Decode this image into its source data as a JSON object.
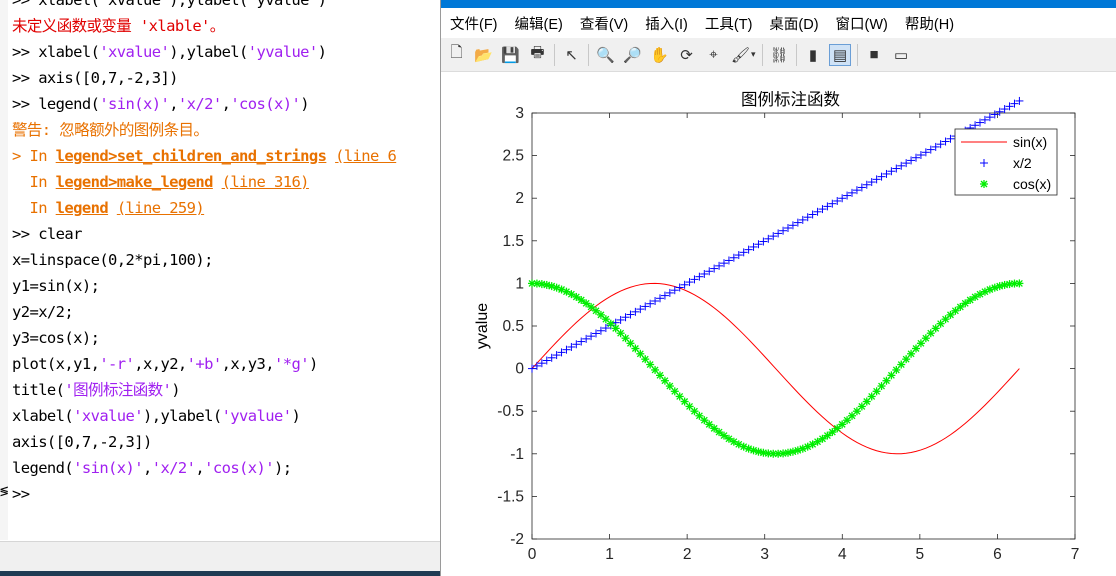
{
  "command_window": {
    "lines": [
      [
        {
          "t": ">> xlabel('xvalue'),ylabel('yvalue')",
          "c": ""
        }
      ],
      [
        {
          "t": "未定义函数或变量 'xlable'。",
          "c": "err"
        }
      ],
      [
        {
          "t": ">> xlabel(",
          "c": ""
        },
        {
          "t": "'xvalue'",
          "c": "s"
        },
        {
          "t": "),ylabel(",
          "c": ""
        },
        {
          "t": "'yvalue'",
          "c": "s"
        },
        {
          "t": ")",
          "c": ""
        }
      ],
      [
        {
          "t": ">> axis([0,7,-2,3])",
          "c": ""
        }
      ],
      [
        {
          "t": ">> legend(",
          "c": ""
        },
        {
          "t": "'sin(x)'",
          "c": "s"
        },
        {
          "t": ",",
          "c": ""
        },
        {
          "t": "'x/2'",
          "c": "s"
        },
        {
          "t": ",",
          "c": ""
        },
        {
          "t": "'cos(x)'",
          "c": "s"
        },
        {
          "t": ")",
          "c": ""
        }
      ],
      [
        {
          "t": "警告: 忽略额外的图例条目。",
          "c": "warn"
        }
      ],
      [
        {
          "t": "> In ",
          "c": "warn"
        },
        {
          "t": "legend>set_children_and_strings",
          "c": "lkb"
        },
        {
          "t": " ",
          "c": "warn"
        },
        {
          "t": "(line 6",
          "c": "lk"
        }
      ],
      [
        {
          "t": "  In ",
          "c": "warn"
        },
        {
          "t": "legend>make_legend",
          "c": "lkb"
        },
        {
          "t": " ",
          "c": "warn"
        },
        {
          "t": "(line 316)",
          "c": "lk"
        }
      ],
      [
        {
          "t": "  In ",
          "c": "warn"
        },
        {
          "t": "legend",
          "c": "lkb"
        },
        {
          "t": " ",
          "c": "warn"
        },
        {
          "t": "(line 259)",
          "c": "lk"
        }
      ],
      [
        {
          "t": ">> clear",
          "c": ""
        }
      ],
      [
        {
          "t": "x=linspace(0,2*pi,100);",
          "c": ""
        }
      ],
      [
        {
          "t": "y1=sin(x);",
          "c": ""
        }
      ],
      [
        {
          "t": "y2=x/2;",
          "c": ""
        }
      ],
      [
        {
          "t": "y3=cos(x);",
          "c": ""
        }
      ],
      [
        {
          "t": "plot(x,y1,",
          "c": ""
        },
        {
          "t": "'-r'",
          "c": "s"
        },
        {
          "t": ",x,y2,",
          "c": ""
        },
        {
          "t": "'+b'",
          "c": "s"
        },
        {
          "t": ",x,y3,",
          "c": ""
        },
        {
          "t": "'*g'",
          "c": "s"
        },
        {
          "t": ")",
          "c": ""
        }
      ],
      [
        {
          "t": "title(",
          "c": ""
        },
        {
          "t": "'图例标注函数'",
          "c": "s"
        },
        {
          "t": ")",
          "c": ""
        }
      ],
      [
        {
          "t": "xlabel(",
          "c": ""
        },
        {
          "t": "'xvalue'",
          "c": "s"
        },
        {
          "t": "),ylabel(",
          "c": ""
        },
        {
          "t": "'yvalue'",
          "c": "s"
        },
        {
          "t": ")",
          "c": ""
        }
      ],
      [
        {
          "t": "axis([0,7,-2,3])",
          "c": ""
        }
      ],
      [
        {
          "t": "legend(",
          "c": ""
        },
        {
          "t": "'sin(x)'",
          "c": "s"
        },
        {
          "t": ",",
          "c": ""
        },
        {
          "t": "'x/2'",
          "c": "s"
        },
        {
          "t": ",",
          "c": ""
        },
        {
          "t": "'cos(x)'",
          "c": "s"
        },
        {
          "t": ");",
          "c": ""
        }
      ],
      [
        {
          "t": ">>",
          "c": ""
        }
      ]
    ],
    "left_marker": "≶"
  },
  "figure_window": {
    "menu": [
      "文件(F)",
      "编辑(E)",
      "查看(V)",
      "插入(I)",
      "工具(T)",
      "桌面(D)",
      "窗口(W)",
      "帮助(H)"
    ],
    "toolbar_icons": [
      "new-figure-icon",
      "open-file-icon",
      "save-icon",
      "print-icon",
      "|",
      "pointer-icon",
      "|",
      "zoom-in-icon",
      "zoom-out-icon",
      "pan-hand-icon",
      "rotate-3d-icon",
      "data-cursor-icon",
      "brush-icon",
      "brush-dropdown-icon",
      "|",
      "link-plot-icon",
      "|",
      "colorbar-icon",
      "legend-icon",
      "|",
      "hide-tools-icon",
      "dock-icon"
    ],
    "active_icon": "legend-icon"
  },
  "chart_data": {
    "type": "line",
    "title": "图例标注函数",
    "xlabel": "",
    "ylabel": "yvalue",
    "xlim": [
      0,
      7
    ],
    "ylim": [
      -2,
      3
    ],
    "xticks": [
      "0",
      "1",
      "2",
      "3",
      "4",
      "5",
      "6",
      "7"
    ],
    "yticks": [
      "-2",
      "-1.5",
      "-1",
      "-0.5",
      "0",
      "0.5",
      "1",
      "1.5",
      "2",
      "2.5",
      "3"
    ],
    "legend_position": "top-right",
    "grid": false,
    "series": [
      {
        "name": "sin(x)",
        "expr": "sin(x)",
        "style": "line",
        "marker": "",
        "color": "#ff0000"
      },
      {
        "name": "x/2",
        "expr": "x/2",
        "style": "marker",
        "marker": "+",
        "color": "#0000ff"
      },
      {
        "name": "cos(x)",
        "expr": "cos(x)",
        "style": "marker",
        "marker": "*",
        "color": "#00ee00"
      }
    ],
    "x_sampling": {
      "start": 0,
      "end": 6.2832,
      "count": 100
    }
  }
}
